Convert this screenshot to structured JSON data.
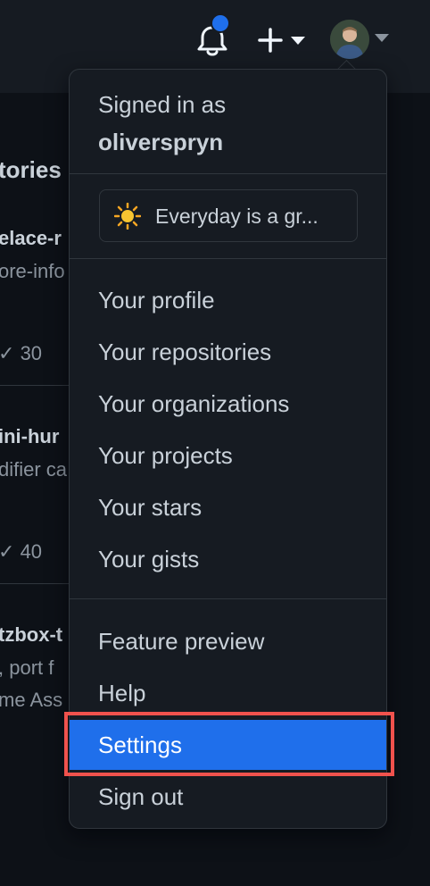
{
  "header": {
    "notifications_icon": "bell-icon",
    "create_icon": "plus-icon",
    "caret_icon": "triangle-down-icon",
    "unread_dot_color": "#1f6feb"
  },
  "background": {
    "section_title_fragment": "tories",
    "repos": [
      {
        "name_fragment": "elace-r",
        "desc_fragment": "ore-info",
        "stars": "30"
      },
      {
        "name_fragment": "ini-hur",
        "desc_fragment": "difier ca",
        "stars": "40"
      },
      {
        "name_fragment": "tzbox-t",
        "desc_fragment": ", port f",
        "desc_fragment_2": "me Ass"
      }
    ]
  },
  "menu": {
    "signed_in_label": "Signed in as",
    "username": "oliverspryn",
    "status": {
      "emoji_icon": "sun-icon",
      "text": "Everyday is a gr..."
    },
    "items": [
      {
        "label": "Your profile"
      },
      {
        "label": "Your repositories"
      },
      {
        "label": "Your organizations"
      },
      {
        "label": "Your projects"
      },
      {
        "label": "Your stars"
      },
      {
        "label": "Your gists"
      }
    ],
    "items_bottom": [
      {
        "label": "Feature preview"
      },
      {
        "label": "Help"
      },
      {
        "label": "Settings",
        "active": true
      },
      {
        "label": "Sign out"
      }
    ]
  },
  "colors": {
    "accent": "#1f6feb",
    "highlight_border": "#f0524d",
    "background": "#0d1117",
    "surface": "#161b22"
  }
}
